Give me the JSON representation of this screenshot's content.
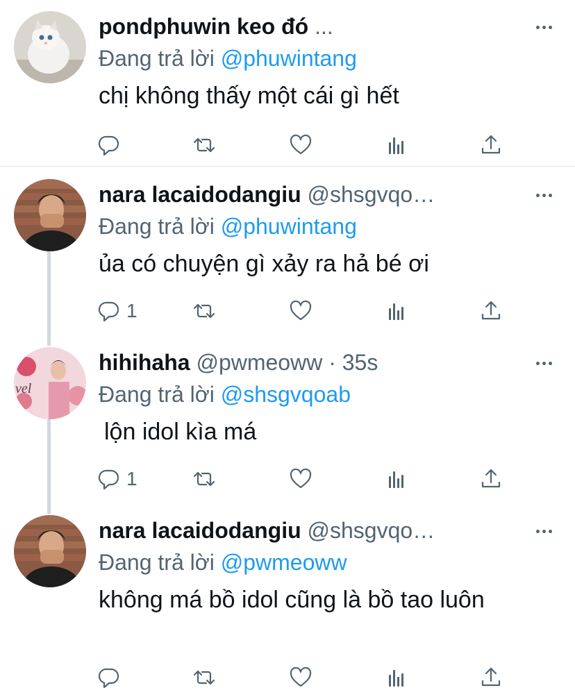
{
  "tweets": [
    {
      "name": "pondphuwin keo đó",
      "handle": "...",
      "time": "",
      "replying_prefix": "Đang trả lời",
      "replying_to": "@phuwintang",
      "text": "chị không thấy một cái gì hết",
      "reply_count": ""
    },
    {
      "name": "nara lacaidodangiu",
      "handle": "@shsgvqo…",
      "time": "",
      "replying_prefix": "Đang trả lời",
      "replying_to": "@phuwintang",
      "text": "ủa có chuyện gì xảy ra hả bé ơi",
      "reply_count": "1"
    },
    {
      "name": "hihihaha",
      "handle": "@pwmeoww",
      "time": "· 35s",
      "replying_prefix": "Đang trả lời",
      "replying_to": "@shsgvqoab",
      "text": "lộn idol kìa má",
      "reply_count": "1"
    },
    {
      "name": "nara lacaidodangiu",
      "handle": "@shsgvqo…",
      "time": "",
      "replying_prefix": "Đang trả lời",
      "replying_to": "@pwmeoww",
      "text": "không má bồ idol cũng là bồ tao luôn",
      "reply_count": ""
    }
  ],
  "colors": {
    "link": "#1d9bf0",
    "secondary_text": "#536471",
    "thread_line": "#cfd9de"
  },
  "icons": [
    "reply-icon",
    "retweet-icon",
    "like-icon",
    "views-icon",
    "share-icon",
    "more-icon"
  ]
}
